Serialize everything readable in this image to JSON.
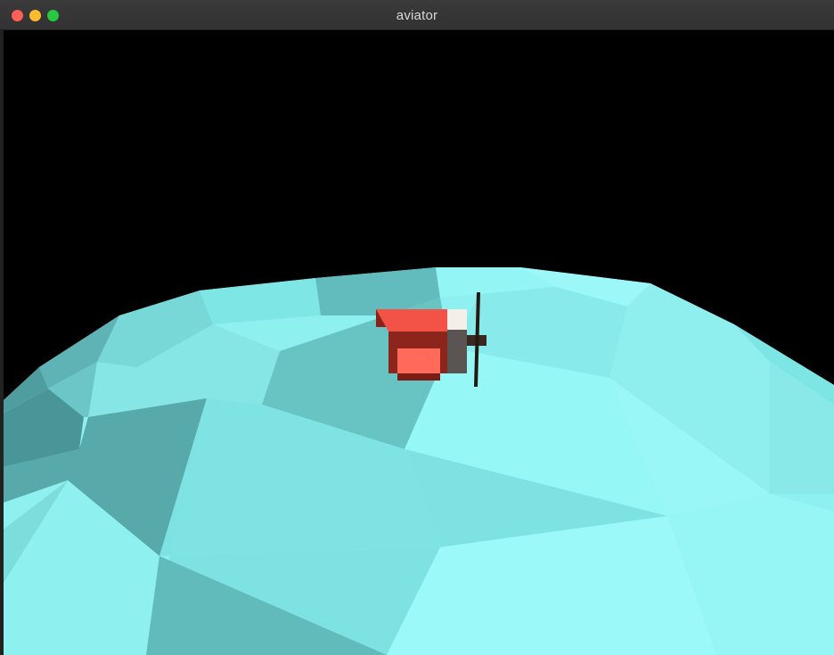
{
  "window": {
    "title": "aviator",
    "controls": [
      {
        "name": "close",
        "color": "#fe5f57"
      },
      {
        "name": "minimize",
        "color": "#febc2e"
      },
      {
        "name": "zoom",
        "color": "#28c840"
      }
    ]
  },
  "scene": {
    "sky_color": "#000000",
    "sea_color": "#68c3c0",
    "airplane": {
      "body_color": "#f25346",
      "body_dark_color": "#a12a20",
      "nose_color": "#f7f4ee",
      "propeller_color": "#23190f"
    }
  }
}
